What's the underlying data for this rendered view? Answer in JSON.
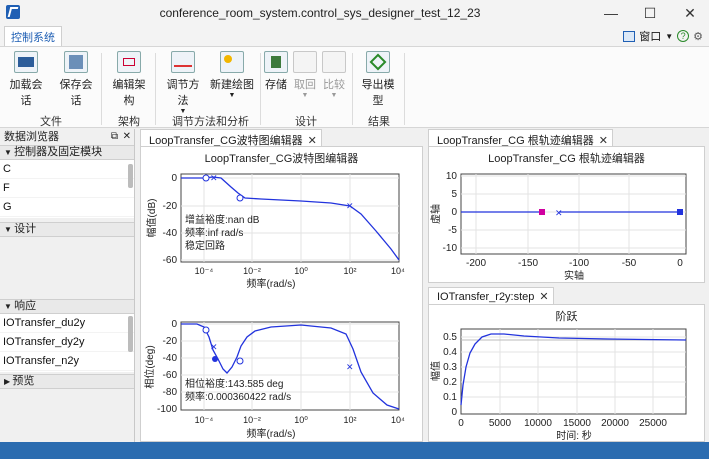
{
  "window": {
    "title": "conference_room_system.control_sys_designer_test_12_23",
    "minimize_glyph": "—",
    "maximize_glyph": "☐",
    "close_glyph": "✕"
  },
  "ribbon_tab": "控制系统",
  "quick_access": {
    "window_label": "窗口",
    "help_glyph": "?",
    "settings_glyph": "⚙"
  },
  "ribbon": {
    "buttons": {
      "load_session": "加载会话",
      "save_session": "保存会话",
      "edit_architecture": "编辑架构",
      "tuning_method": "调节方法",
      "new_plot": "新建绘图",
      "store": "存储",
      "retrieve": "取回",
      "compare": "比较",
      "export_model": "导出模型"
    },
    "groups": {
      "file": "文件",
      "architecture": "架构",
      "tuning_analysis": "调节方法和分析",
      "design": "设计",
      "results": "结果"
    }
  },
  "data_browser": {
    "title": "数据浏览器",
    "sections": {
      "controllers": "控制器及固定模块",
      "designs": "设计",
      "responses": "响应",
      "preview": "预览"
    },
    "controller_items": [
      "C",
      "F",
      "G"
    ],
    "response_items": [
      "IOTransfer_du2y",
      "IOTransfer_dy2y",
      "IOTransfer_n2y"
    ]
  },
  "bode_editor": {
    "tab_label": "LoopTransfer_CG波特图编辑器",
    "title": "LoopTransfer_CG波特图编辑器",
    "mag_ylabel": "幅值(dB)",
    "phase_ylabel": "相位(deg)",
    "xlabel": "频率(rad/s)",
    "mag_yticks": [
      "0",
      "-20",
      "-40",
      "-60"
    ],
    "phase_yticks": [
      "0",
      "-20",
      "-40",
      "-60",
      "-80",
      "-100"
    ],
    "xticks": [
      "10⁻⁴",
      "10⁻²",
      "10⁰",
      "10²",
      "10⁴"
    ],
    "gain_margin_text": "增益裕度:nan dB",
    "gain_freq_text": "频率:inf rad/s",
    "stable_text": "稳定回路",
    "phase_margin_text": "相位裕度:143.585 deg",
    "phase_freq_text": "频率:0.000360422 rad/s"
  },
  "root_locus": {
    "tab_label": "LoopTransfer_CG 根轨迹编辑器",
    "title": "LoopTransfer_CG 根轨迹编辑器",
    "ylabel": "虚轴",
    "xlabel": "实轴",
    "yticks": [
      "10",
      "5",
      "0",
      "-5",
      "-10"
    ],
    "xticks": [
      "-200",
      "-150",
      "-100",
      "-50",
      "0"
    ]
  },
  "step_plot": {
    "tab_label": "IOTransfer_r2y:step",
    "title": "阶跃",
    "ylabel": "幅值",
    "xlabel": "时间:  秒",
    "yticks": [
      "0.5",
      "0.4",
      "0.3",
      "0.2",
      "0.1",
      "0"
    ],
    "xticks": [
      "0",
      "5000",
      "10000",
      "15000",
      "20000",
      "25000"
    ]
  },
  "colors": {
    "accent": "#1f5fb4",
    "curve": "#2233dd",
    "pole_marker": "#d000a0",
    "status_bar": "#2b6cb0"
  }
}
